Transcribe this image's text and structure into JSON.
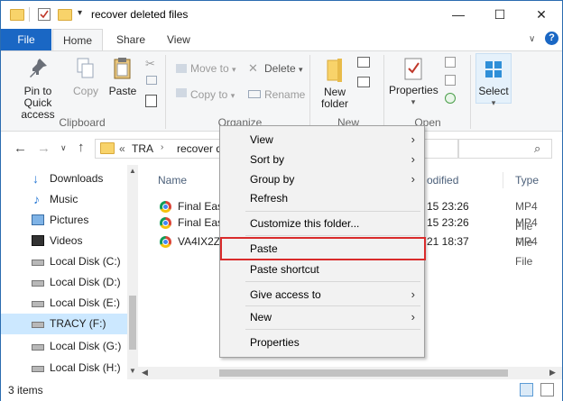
{
  "window": {
    "title": "recover deleted files",
    "minimize": "—",
    "maximize": "☐",
    "close": "✕"
  },
  "ribbon_tabs": [
    "File",
    "Home",
    "Share",
    "View"
  ],
  "ribbon": {
    "clipboard": {
      "label": "Clipboard",
      "pin_to_quick_access": "Pin to Quick access",
      "copy": "Copy",
      "paste": "Paste"
    },
    "organize": {
      "label": "Organize",
      "move_to": "Move to",
      "copy_to": "Copy to",
      "delete": "Delete",
      "rename": "Rename"
    },
    "new": {
      "label": "New",
      "new_folder": "New folder"
    },
    "open": {
      "label": "Open",
      "properties": "Properties"
    },
    "select": {
      "select": "Select"
    }
  },
  "address": {
    "overflow": "«",
    "crumb_1": "TRA",
    "crumb_2": "recover d"
  },
  "nav_items": [
    {
      "label": "Downloads",
      "icon": "download-arrow-icon"
    },
    {
      "label": "Music",
      "icon": "music-note-icon"
    },
    {
      "label": "Pictures",
      "icon": "pictures-icon"
    },
    {
      "label": "Videos",
      "icon": "videos-icon"
    },
    {
      "label": "Local Disk (C:)",
      "icon": "drive-icon"
    },
    {
      "label": "Local Disk (D:)",
      "icon": "drive-icon"
    },
    {
      "label": "Local Disk (E:)",
      "icon": "drive-icon"
    },
    {
      "label": "TRACY (F:)",
      "icon": "drive-icon",
      "selected": true
    },
    {
      "label": "Local Disk (G:)",
      "icon": "drive-icon"
    },
    {
      "label": "Local Disk (H:)",
      "icon": "drive-icon"
    }
  ],
  "columns": {
    "name": "Name",
    "modified": "odified",
    "type": "Type"
  },
  "files": [
    {
      "name": "Final Ease",
      "modified": "15 23:26",
      "type": "MP4 File"
    },
    {
      "name": "Final Ease",
      "modified": "15 23:26",
      "type": "MP4 File"
    },
    {
      "name": "VA4IX2ZH",
      "modified": "21 18:37",
      "type": "MP4 File"
    }
  ],
  "status": {
    "items": "3 items"
  },
  "context_menu": {
    "view": "View",
    "sort_by": "Sort by",
    "group_by": "Group by",
    "refresh": "Refresh",
    "customize": "Customize this folder...",
    "paste": "Paste",
    "paste_shortcut": "Paste shortcut",
    "give_access": "Give access to",
    "new": "New",
    "properties": "Properties",
    "arrow": "›"
  },
  "colors": {
    "accent": "#1a67c4",
    "highlight": "#d92b2b"
  }
}
